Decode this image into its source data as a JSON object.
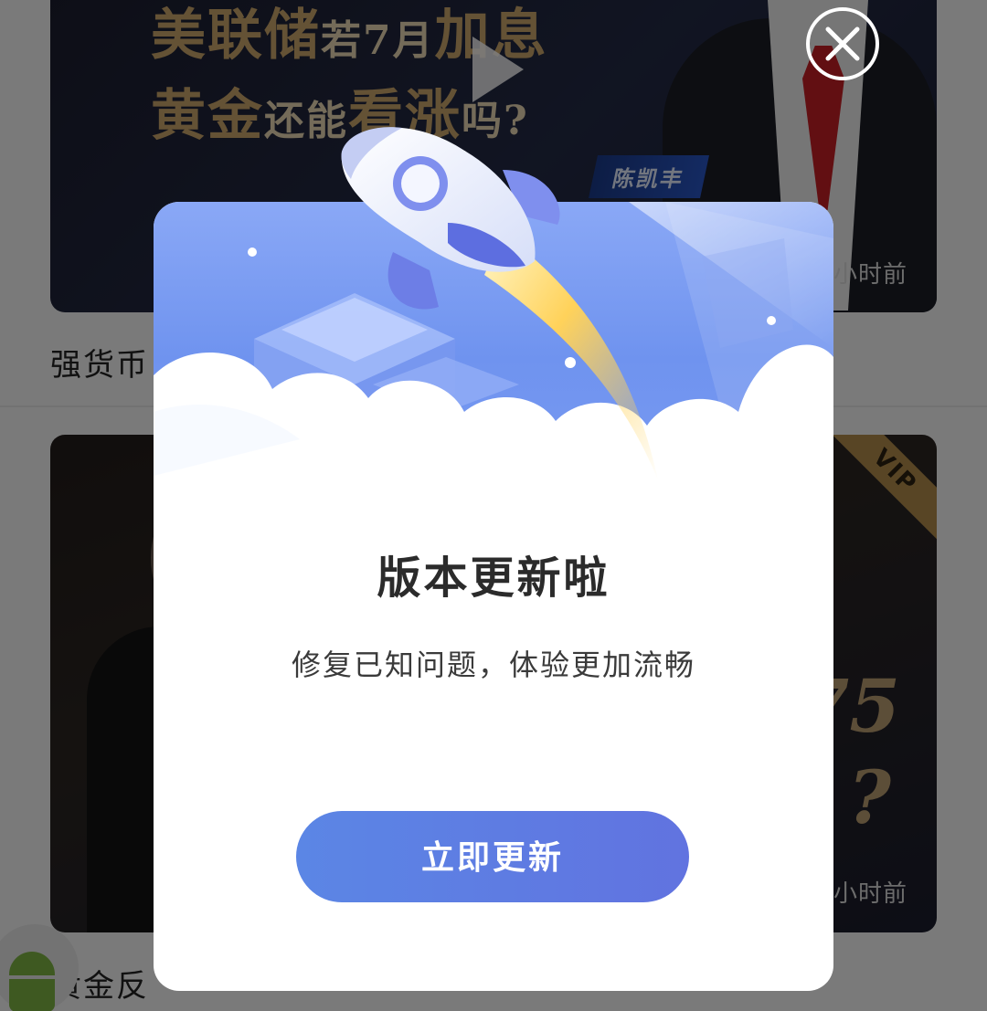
{
  "feed": {
    "card1": {
      "headline_line1_a": "美联储",
      "headline_line1_b": "若7月",
      "headline_line1_c": "加息",
      "headline_line2_a": "黄金",
      "headline_line2_b": "还能",
      "headline_line2_c": "看涨",
      "headline_line2_d": "吗?",
      "presenter_name": "陈凯丰",
      "time_ago": "小时前",
      "title": "强货币"
    },
    "card2": {
      "vip": "VIP",
      "number_fragment": "75",
      "question_fragment": "?",
      "time_ago": "小时前",
      "title": "黄金反"
    }
  },
  "dialog": {
    "title": "版本更新啦",
    "message": "修复已知问题，体验更加流畅",
    "update_button_label": "立即更新"
  },
  "colors": {
    "button_start": "#5b86e5",
    "button_end": "#6173e0",
    "hero_blue": "#7d9df2",
    "overlay": "rgba(0,0,0,0.5)"
  }
}
